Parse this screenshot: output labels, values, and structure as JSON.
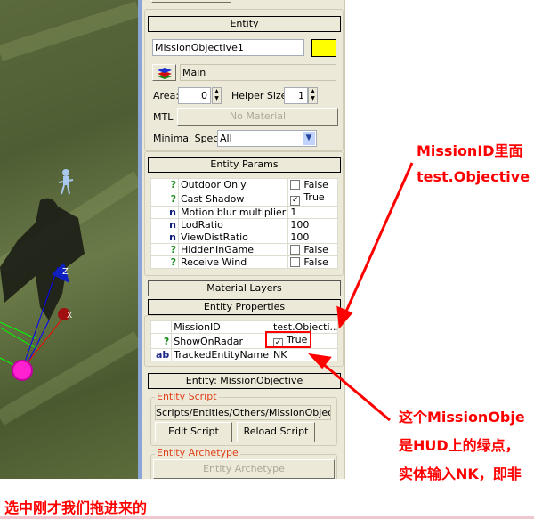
{
  "entity_panel": {
    "header": "Entity",
    "name": "MissionObjective1",
    "color": "#ffff00",
    "layer": "Main",
    "area_label": "Area:",
    "area": "0",
    "helper_size_label": "Helper Size:",
    "helper_size": "1",
    "mtl_label": "MTL",
    "material": "No Material",
    "min_spec_label": "Minimal Spec:",
    "min_spec": "All"
  },
  "entity_params": {
    "header": "Entity Params",
    "rows": [
      {
        "icon": "?",
        "name": "Outdoor Only",
        "value": "False",
        "check": ""
      },
      {
        "icon": "?",
        "name": "Cast Shadow",
        "value": "True",
        "check": "✓"
      },
      {
        "icon": "n",
        "name": "Motion blur multiplier",
        "value": "1"
      },
      {
        "icon": "n",
        "name": "LodRatio",
        "value": "100"
      },
      {
        "icon": "n",
        "name": "ViewDistRatio",
        "value": "100"
      },
      {
        "icon": "?",
        "name": "HiddenInGame",
        "value": "False",
        "check": ""
      },
      {
        "icon": "?",
        "name": "Receive Wind",
        "value": "False",
        "check": ""
      }
    ]
  },
  "material_layers": {
    "header": "Material Layers"
  },
  "entity_properties": {
    "header": "Entity Properties",
    "rows": [
      {
        "icon": "",
        "name": "MissionID",
        "value": "test.Objecti..."
      },
      {
        "icon": "?",
        "name": "ShowOnRadar",
        "value": "True",
        "check": "✓"
      },
      {
        "icon": "ab",
        "name": "TrackedEntityName",
        "value": "NK"
      }
    ]
  },
  "entity_class": {
    "header": "Entity: MissionObjective",
    "script_group": "Entity Script",
    "script_path": "Scripts/Entities/Others/MissionObjective.",
    "edit_script": "Edit Script",
    "reload_script": "Reload Script",
    "archetype_group": "Entity Archetype",
    "archetype_button": "Entity Archetype"
  },
  "viewport": {
    "axis_z": "Z",
    "axis_x": "X"
  },
  "annotations": {
    "a1_line1": "MissionID里面",
    "a1_line2": "test.Objective",
    "a2_line1": "这个MissionObje",
    "a2_line2": "是HUD上的绿点，",
    "a2_line3": "实体输入NK，即非",
    "bottom": "选中刚才我们拖进来的",
    "color": "#ff0000"
  }
}
